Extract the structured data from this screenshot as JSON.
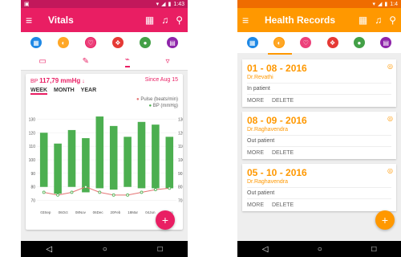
{
  "vitals": {
    "status_time": "1:43",
    "title": "Vitals",
    "bp_label": "BP",
    "bp_value": "117,79 mmHg",
    "bp_arrow": "↓",
    "since": "Since Aug 15",
    "ranges": [
      "WEEK",
      "MONTH",
      "YEAR"
    ],
    "fab": "+",
    "colors": {
      "primary": "#e91e63",
      "status": "#c2185b",
      "bar": "#4caf50",
      "pulse": "#e57373"
    }
  },
  "chart_data": {
    "type": "bar",
    "legend": [
      "Pulse (beats/min)",
      "BP (mmHg)"
    ],
    "y_ticks": [
      "130",
      "120",
      "110",
      "100",
      "90",
      "80",
      "70"
    ],
    "ylim": [
      65,
      135
    ],
    "x_labels": [
      "03Sep",
      "06Oct",
      "08Nov",
      "06Dec",
      "20Feb",
      "18Mar",
      "04Jun",
      "15Aug"
    ],
    "bp_ranges": [
      [
        80,
        120
      ],
      [
        75,
        112
      ],
      [
        80,
        122
      ],
      [
        76,
        116
      ],
      [
        79,
        132
      ],
      [
        78,
        125
      ],
      [
        80,
        117
      ],
      [
        79,
        128
      ],
      [
        79,
        126
      ],
      [
        79,
        117
      ]
    ],
    "pulse": [
      76,
      74,
      76,
      80,
      76,
      74,
      74,
      76,
      78,
      79
    ]
  },
  "records": {
    "status_time": "1:4",
    "title": "Health Records",
    "fab": "+",
    "more_label": "MORE",
    "delete_label": "DELETE",
    "items": [
      {
        "date": "01 - 08 - 2016",
        "doctor": "Dr.Revathi",
        "type": "In patient"
      },
      {
        "date": "08 - 09 - 2016",
        "doctor": "Dr.Raghavendra",
        "type": "Out patient"
      },
      {
        "date": "05 - 10 - 2016",
        "doctor": "Dr.Raghavendra",
        "type": "Out patient"
      }
    ],
    "colors": {
      "primary": "#ff9800",
      "status": "#ef6c00"
    }
  },
  "icons": {
    "category_colors": [
      "#1e88e5",
      "#ffa726",
      "#ec407a",
      "#e53935",
      "#43a047",
      "#8e24aa"
    ],
    "category_glyphs": [
      "▦",
      "◐",
      "♡",
      "❖",
      "●",
      "▤"
    ]
  }
}
